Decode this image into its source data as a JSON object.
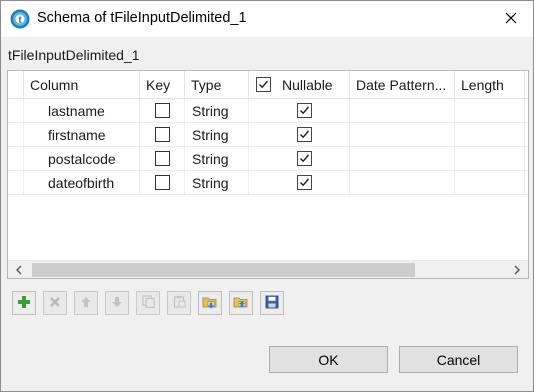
{
  "window": {
    "title": "Schema of tFileInputDelimited_1",
    "app_icon": "talend-icon",
    "close_icon": "close-icon"
  },
  "schema_name": "tFileInputDelimited_1",
  "table": {
    "columns": [
      "Column",
      "Key",
      "Type",
      "Nullable",
      "Date Pattern...",
      "Length"
    ],
    "nullable_header_checked": true,
    "rows": [
      {
        "column": "lastname",
        "key": false,
        "type": "String",
        "nullable": true,
        "date_pattern": "",
        "length": ""
      },
      {
        "column": "firstname",
        "key": false,
        "type": "String",
        "nullable": true,
        "date_pattern": "",
        "length": ""
      },
      {
        "column": "postalcode",
        "key": false,
        "type": "String",
        "nullable": true,
        "date_pattern": "",
        "length": ""
      },
      {
        "column": "dateofbirth",
        "key": false,
        "type": "String",
        "nullable": true,
        "date_pattern": "",
        "length": ""
      }
    ]
  },
  "toolbar": {
    "buttons": [
      {
        "name": "add-icon",
        "enabled": true
      },
      {
        "name": "delete-icon",
        "enabled": false
      },
      {
        "name": "move-up-icon",
        "enabled": false
      },
      {
        "name": "move-down-icon",
        "enabled": false
      },
      {
        "name": "copy-icon",
        "enabled": false
      },
      {
        "name": "paste-icon",
        "enabled": false
      },
      {
        "name": "import-icon",
        "enabled": true
      },
      {
        "name": "export-icon",
        "enabled": true
      },
      {
        "name": "save-icon",
        "enabled": true
      }
    ]
  },
  "buttons": {
    "ok": "OK",
    "cancel": "Cancel"
  },
  "colors": {
    "accent_green": "#3a9d3a",
    "talend_blue": "#1f7fb5",
    "disabled_gray": "#b8b8b8"
  }
}
